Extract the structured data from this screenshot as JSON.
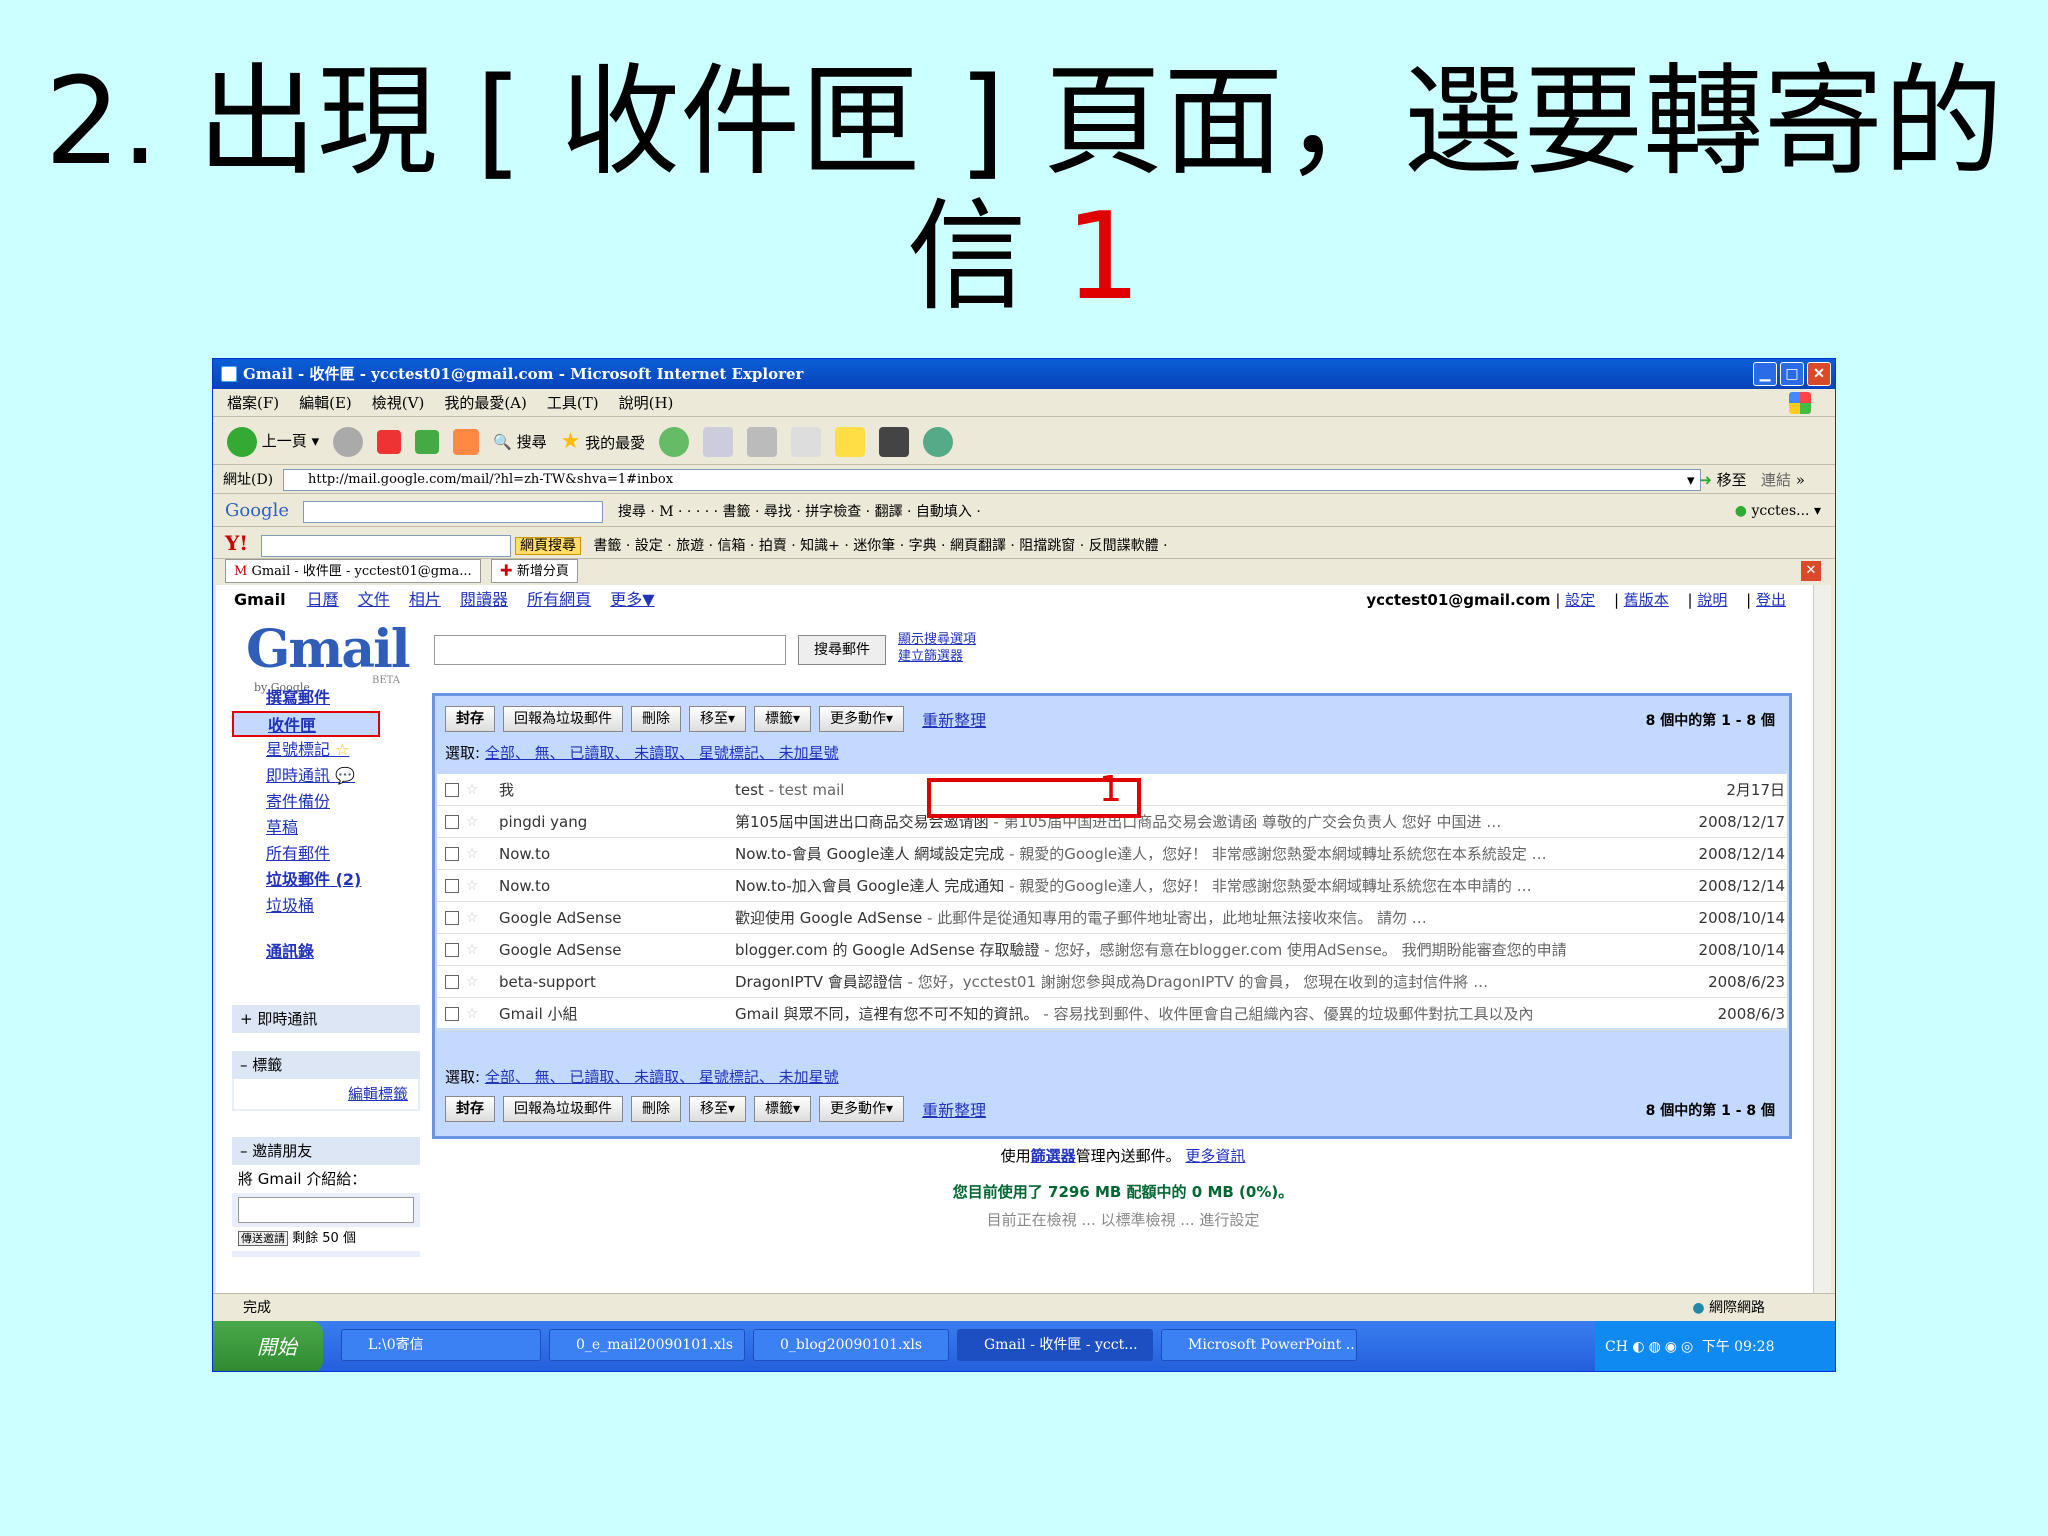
{
  "slide": {
    "title_line1": "2. 出現 [ 收件匣 ] 頁面，選要轉寄的",
    "title_line2": "信 ",
    "title_num": "1"
  },
  "window": {
    "title": "Gmail - 收件匣 - ycctest01@gmail.com - Microsoft Internet Explorer"
  },
  "menu": [
    "檔案(F)",
    "編輯(E)",
    "檢視(V)",
    "我的最愛(A)",
    "工具(T)",
    "說明(H)"
  ],
  "toolbar": {
    "back": "上一頁",
    "search": "搜尋",
    "favorites": "我的最愛"
  },
  "address": {
    "label": "網址(D)",
    "url": "http://mail.google.com/mail/?hl=zh-TW&shva=1#inbox",
    "go": "移至",
    "links": "連結"
  },
  "googlebar": {
    "brand": "Google",
    "items": "搜尋 · M · · · · ·  書籤 ·  尋找 ·  拼字檢查 ·  翻譯 ·  自動填入 ·",
    "account": "ycctes..."
  },
  "yahoobar": {
    "brand": "Y!",
    "search": "網頁搜尋",
    "items": "書籤 ·  設定 ·  旅遊 ·  信箱 ·  拍賣 ·  知識+ ·  迷你筆 ·  字典 ·  網頁翻譯 ·  阻擋跳窗 ·  反間諜軟體 ·"
  },
  "tabs": {
    "current": "Gmail - 收件匣 - ycctest01@gma...",
    "new": "新增分頁"
  },
  "gmail": {
    "topnav": {
      "brand": "Gmail",
      "links": [
        "日曆",
        "文件",
        "相片",
        "閱讀器",
        "所有網頁",
        "更多▼"
      ]
    },
    "account": "ycctest01@gmail.com",
    "account_links": [
      "設定",
      "舊版本",
      "說明",
      "登出"
    ],
    "logo": "Gmail",
    "logo_by": "by Google",
    "logo_beta": "BETA",
    "search_button": "搜尋郵件",
    "search_opts": [
      "顯示搜尋選項",
      "建立篩選器"
    ],
    "nav": {
      "compose": "撰寫郵件",
      "inbox": "收件匣",
      "starred": "星號標記",
      "chats": "即時通訊",
      "sent": "寄件備份",
      "drafts": "草稿",
      "all": "所有郵件",
      "spam": "垃圾郵件 (2)",
      "trash": "垃圾桶",
      "contacts": "通訊錄"
    },
    "boxes": {
      "chat": "即時通訊",
      "labels": "標籤",
      "edit_labels": "編輯標籤",
      "invite": "邀請朋友",
      "invite_text": "將 Gmail 介紹給：",
      "invite_btn": "傳送邀請",
      "invite_left": "剩餘 50 個"
    },
    "actions": {
      "archive": "封存",
      "spam": "回報為垃圾郵件",
      "delete": "刪除",
      "move": "移至▾",
      "labels": "標籤▾",
      "more": "更多動作▾",
      "refresh": "重新整理",
      "count": "8 個中的第 1 - 8 個"
    },
    "select": {
      "label": "選取:",
      "links": "全部、 無、 已讀取、 未讀取、 星號標記、 未加星號"
    },
    "messages": [
      {
        "from": "我",
        "subject": "test",
        "snippet": " - test mail",
        "date": "2月17日"
      },
      {
        "from": "pingdi yang",
        "subject": "第105屆中国进出口商品交易会邀请函",
        "snippet": " - 第105届中国进出口商品交易会邀请函 尊敬的广交会负责人 您好 中国进 …",
        "date": "2008/12/17"
      },
      {
        "from": "Now.to",
        "subject": "Now.to-會員 Google達人 網域設定完成",
        "snippet": " - 親愛的Google達人，您好！ 非常感謝您熱愛本網域轉址系統您在本系統設定 …",
        "date": "2008/12/14"
      },
      {
        "from": "Now.to",
        "subject": "Now.to-加入會員 Google達人 完成通知",
        "snippet": " - 親愛的Google達人，您好！ 非常感謝您熱愛本網域轉址系統您在本申請的 …",
        "date": "2008/12/14"
      },
      {
        "from": "Google AdSense",
        "subject": "歡迎使用 Google AdSense",
        "snippet": " - 此郵件是從通知專用的電子郵件地址寄出，此地址無法接收來信。 請勿 …",
        "date": "2008/10/14"
      },
      {
        "from": "Google AdSense",
        "subject": "blogger.com 的 Google AdSense 存取驗證",
        "snippet": " - 您好，感謝您有意在blogger.com 使用AdSense。 我們期盼能審查您的申請",
        "date": "2008/10/14"
      },
      {
        "from": "beta-support",
        "subject": "DragonIPTV 會員認證信",
        "snippet": " - 您好，ycctest01 謝謝您參與成為DragonIPTV 的會員， 您現在收到的這封信件將 …",
        "date": "2008/6/23"
      },
      {
        "from": "Gmail 小組",
        "subject": "Gmail 與眾不同，這裡有您不可不知的資訊。",
        "snippet": " - 容易找到郵件、收件匣會自己組織內容、優異的垃圾郵件對抗工具以及內",
        "date": "2008/6/3"
      }
    ],
    "annotation": "1",
    "footer": {
      "filter_pre": "使用",
      "filter_link": "篩選器",
      "filter_post": "管理內送郵件。",
      "more": "更多資訊",
      "usage": "您目前使用了 7296 MB 配額中的 0 MB (0%)。",
      "cut": "目前正在檢視 ... 以標準檢視 ... 進行設定"
    }
  },
  "status": {
    "done": "完成",
    "zone": "網際網路"
  },
  "taskbar": {
    "start": "開始",
    "items": [
      "L:\\0寄信",
      "0_e_mail20090101.xls",
      "0_blog20090101.xls",
      "Gmail - 收件匣 - ycct...",
      "Microsoft PowerPoint ..."
    ],
    "lang": "CH",
    "clock": "下午 09:28"
  },
  "colors": {
    "bg": "#ccffff",
    "accent": "#e00000",
    "xp_blue": "#245edb",
    "gmail_blue": "#c3d9ff"
  }
}
